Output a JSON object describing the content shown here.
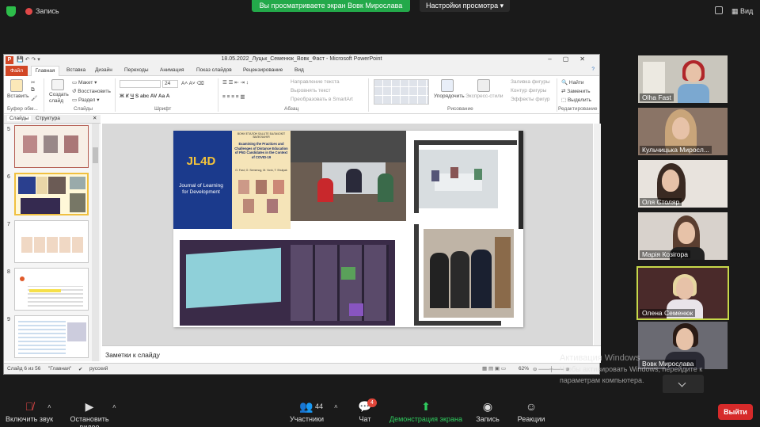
{
  "topbar": {
    "recording_label": "Запись",
    "share_banner": "Вы просматриваете экран Вовк Мирослава",
    "view_options": "Настройки просмотра",
    "view_button": "Вид"
  },
  "ppt": {
    "window_title": "18.05.2022_Луцьк_Семенюк_Вовк_Фаст - Microsoft PowerPoint",
    "tabs": [
      "Файл",
      "Главная",
      "Вставка",
      "Дизайн",
      "Переходы",
      "Анимация",
      "Показ слайдов",
      "Рецензирование",
      "Вид"
    ],
    "ribbon": {
      "paste": "Вставить",
      "new_slide": "Создать слайд",
      "layout": "Макет",
      "reset": "Восстановить",
      "section": "Раздел",
      "font_size": "24",
      "text_direction": "Направление текста",
      "align_text": "Выровнять текст",
      "convert_smartart": "Преобразовать в SmartArt",
      "arrange": "Упорядочить",
      "quick_styles": "Экспресс-стили",
      "shape_fill": "Заливка фигуры",
      "shape_outline": "Контур фигуры",
      "shape_effects": "Эффекты фигур",
      "find": "Найти",
      "replace": "Заменить",
      "select": "Выделить",
      "groups": {
        "clipboard": "Буфер обм...",
        "slides": "Слайды",
        "font": "Шрифт",
        "paragraph": "Абзац",
        "drawing": "Рисование",
        "editing": "Редактирование"
      }
    },
    "pane_tabs": [
      "Слайды",
      "Структура"
    ],
    "thumbnails": [
      "5",
      "6",
      "7",
      "8",
      "9"
    ],
    "slide": {
      "journal_acronym": "JL4D",
      "journal_title": "Journal of Learning for Development",
      "article_header": "ВОНИ ЕТАЛОН SALUTE БАЛАЧОЮТ ВАЛЮЧАНІЯ",
      "article_title": "Examining the Practices and Challenges of Distance Education of PhD Candidates in the Context of COVID-19",
      "article_authors": "O. Fast, O. Semenog, M. Vovk, T. Shulyak"
    },
    "notes_placeholder": "Заметки к слайду",
    "status": {
      "slide_counter": "Слайд 6 из 56",
      "theme": "\"Главная\"",
      "language": "русский",
      "zoom": "62%"
    }
  },
  "participants": [
    {
      "name": "Olha Fast"
    },
    {
      "name": "Кульчицька Миросл..."
    },
    {
      "name": "Оля Столяр"
    },
    {
      "name": "Марія Козігора"
    },
    {
      "name": "Олена Семенюк"
    },
    {
      "name": "Вовк Мирослава"
    }
  ],
  "watermark": {
    "line1": "Активация Windows",
    "line2": "Чтобы активировать Windows, перейдите к",
    "line3": "параметрам компьютера."
  },
  "toolbar": {
    "mute": "Включить звук",
    "video": "Остановить видео",
    "participants": "Участники",
    "participants_count": "44",
    "chat": "Чат",
    "chat_badge": "4",
    "share": "Демонстрация экрана",
    "record": "Запись",
    "reactions": "Реакции",
    "leave": "Выйти"
  },
  "colors": {
    "zoom_green": "#23a94a",
    "ppt_orange": "#d24726",
    "leave_red": "#d62a2a",
    "active_speaker": "#c7d94a"
  }
}
